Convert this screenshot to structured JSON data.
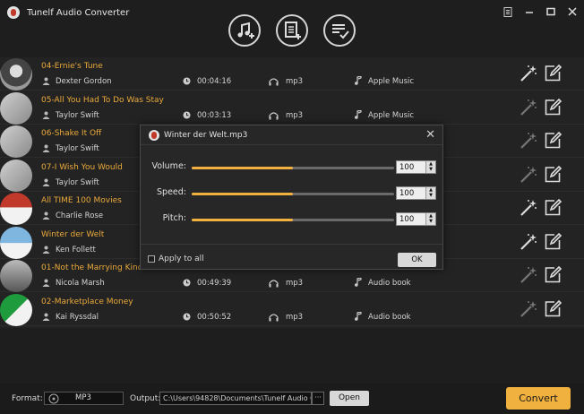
{
  "app": {
    "title": "Tunelf Audio Converter"
  },
  "toolbar": {
    "buttons": [
      {
        "name": "add-music",
        "icon": "music-add-icon"
      },
      {
        "name": "add-file",
        "icon": "file-add-icon"
      },
      {
        "name": "history",
        "icon": "list-check-icon"
      }
    ]
  },
  "tracks": [
    {
      "title": "04-Ernie's Tune",
      "artist": "Dexter Gordon",
      "duration": "00:04:16",
      "format": "mp3",
      "source": "Apple Music"
    },
    {
      "title": "05-All You Had To Do Was Stay",
      "artist": "Taylor Swift",
      "duration": "00:03:13",
      "format": "mp3",
      "source": "Apple Music"
    },
    {
      "title": "06-Shake It Off",
      "artist": "Taylor Swift",
      "duration": "",
      "format": "",
      "source": ""
    },
    {
      "title": "07-I Wish You Would",
      "artist": "Taylor Swift",
      "duration": "",
      "format": "",
      "source": ""
    },
    {
      "title": "All TIME 100 Movies",
      "artist": "Charlie Rose",
      "duration": "",
      "format": "",
      "source": ""
    },
    {
      "title": "Winter der Welt",
      "artist": "Ken Follett",
      "duration": "",
      "format": "",
      "source": ""
    },
    {
      "title": "01-Not the Marrying Kind",
      "artist": "Nicola Marsh",
      "duration": "00:49:39",
      "format": "mp3",
      "source": "Audio book"
    },
    {
      "title": "02-Marketplace Money",
      "artist": "Kai Ryssdal",
      "duration": "00:50:52",
      "format": "mp3",
      "source": "Audio book"
    }
  ],
  "dialog": {
    "title": "Winter der Welt.mp3",
    "volume_label": "Volume:",
    "volume_value": "100",
    "volume_level": 0.5,
    "speed_label": "Speed:",
    "speed_value": "100",
    "speed_level": 0.5,
    "pitch_label": "Pitch:",
    "pitch_value": "100",
    "pitch_level": 0.5,
    "apply_label": "Apply to all",
    "ok_label": "OK"
  },
  "bottom": {
    "format_label": "Format:",
    "format_value": "MP3",
    "output_label": "Output:",
    "output_path": "C:\\Users\\94828\\Documents\\Tunelf Audio Com",
    "browse_label": "···",
    "open_label": "Open",
    "convert_label": "Convert"
  },
  "colors": {
    "accent": "#f0b13e",
    "title_text": "#e9a93b",
    "background": "#1e1e1e"
  }
}
